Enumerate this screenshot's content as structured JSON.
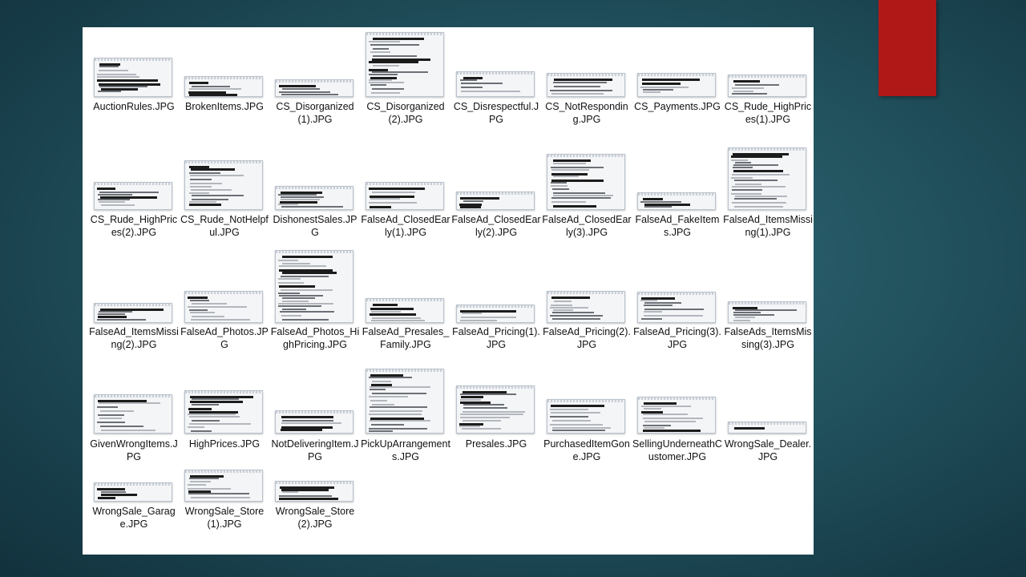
{
  "files": [
    {
      "name": "AuctionRules.JPG",
      "thumb_size": "medium"
    },
    {
      "name": "BrokenItems.JPG",
      "thumb_size": "small"
    },
    {
      "name": "CS_Disorganized(1).JPG",
      "thumb_size": "small"
    },
    {
      "name": "CS_Disorganized(2).JPG",
      "thumb_size": "tall"
    },
    {
      "name": "CS_Disrespectful.JPG",
      "thumb_size": "small"
    },
    {
      "name": "CS_NotResponding.JPG",
      "thumb_size": "small"
    },
    {
      "name": "CS_Payments.JPG",
      "thumb_size": "small"
    },
    {
      "name": "CS_Rude_HighPrices(1).JPG",
      "thumb_size": "small"
    },
    {
      "name": "CS_Rude_HighPrices(2).JPG",
      "thumb_size": "small"
    },
    {
      "name": "CS_Rude_NotHelpful.JPG",
      "thumb_size": "medium"
    },
    {
      "name": "DishonestSales.JPG",
      "thumb_size": "small"
    },
    {
      "name": "FalseAd_ClosedEarly(1).JPG",
      "thumb_size": "small"
    },
    {
      "name": "FalseAd_ClosedEarly(2).JPG",
      "thumb_size": "small"
    },
    {
      "name": "FalseAd_ClosedEarly(3).JPG",
      "thumb_size": "large"
    },
    {
      "name": "FalseAd_FakeItems.JPG",
      "thumb_size": "small"
    },
    {
      "name": "FalseAd_ItemsMissing(1).JPG",
      "thumb_size": "large"
    },
    {
      "name": "FalseAd_ItemsMissing(2).JPG",
      "thumb_size": "small"
    },
    {
      "name": "FalseAd_Photos.JPG",
      "thumb_size": "small"
    },
    {
      "name": "FalseAd_Photos_HighPricing.JPG",
      "thumb_size": "tall"
    },
    {
      "name": "FalseAd_Presales_Family.JPG",
      "thumb_size": "small"
    },
    {
      "name": "FalseAd_Pricing(1).JPG",
      "thumb_size": "small"
    },
    {
      "name": "FalseAd_Pricing(2).JPG",
      "thumb_size": "small"
    },
    {
      "name": "FalseAd_Pricing(3).JPG",
      "thumb_size": "small"
    },
    {
      "name": "FalseAds_ItemsMissing(3).JPG",
      "thumb_size": "small"
    },
    {
      "name": "GivenWrongItems.JPG",
      "thumb_size": "small"
    },
    {
      "name": "HighPrices.JPG",
      "thumb_size": "medium"
    },
    {
      "name": "NotDeliveringItem.JPG",
      "thumb_size": "small"
    },
    {
      "name": "PickUpArrangements.JPG",
      "thumb_size": "tall"
    },
    {
      "name": "Presales.JPG",
      "thumb_size": "medium"
    },
    {
      "name": "PurchasedItemGone.JPG",
      "thumb_size": "small"
    },
    {
      "name": "SellingUnderneathCustomer.JPG",
      "thumb_size": "medium"
    },
    {
      "name": "WrongSale_Dealer.JPG",
      "thumb_size": "small"
    },
    {
      "name": "WrongSale_Garage.JPG",
      "thumb_size": "small"
    },
    {
      "name": "WrongSale_Store(1).JPG",
      "thumb_size": "small"
    },
    {
      "name": "WrongSale_Store(2).JPG",
      "thumb_size": "small"
    }
  ],
  "colors": {
    "accent": "#b01818",
    "background": "#22535f",
    "panel": "#ffffff"
  }
}
